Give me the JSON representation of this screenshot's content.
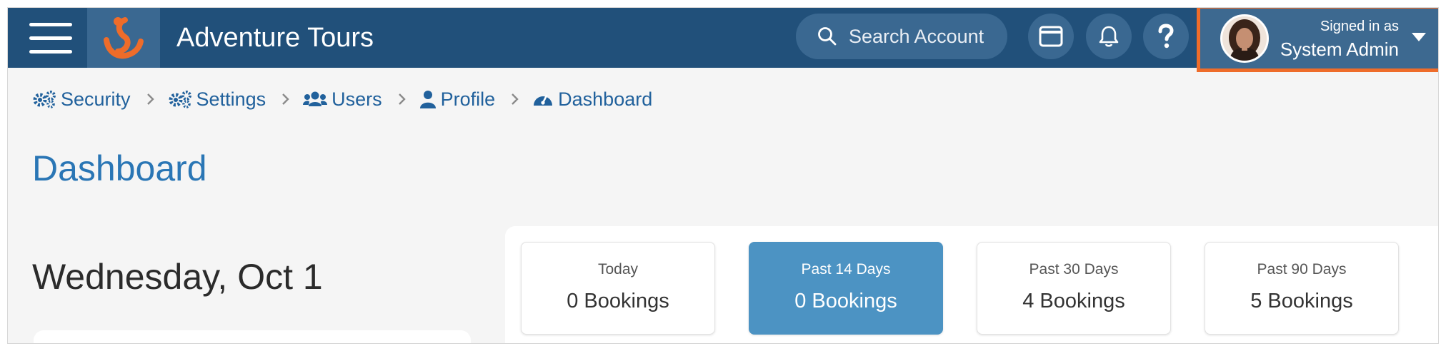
{
  "app": {
    "title": "Adventure Tours"
  },
  "search": {
    "placeholder": "Search Account"
  },
  "user": {
    "signed_in_label": "Signed in as",
    "name": "System Admin"
  },
  "breadcrumb": [
    {
      "label": "Security",
      "icon": "gears-icon"
    },
    {
      "label": "Settings",
      "icon": "gears-icon"
    },
    {
      "label": "Users",
      "icon": "users-icon"
    },
    {
      "label": "Profile",
      "icon": "user-icon"
    },
    {
      "label": "Dashboard",
      "icon": "gauge-icon"
    }
  ],
  "page": {
    "title": "Dashboard",
    "date": "Wednesday, Oct 1"
  },
  "stats": [
    {
      "period": "Today",
      "count": "0 Bookings",
      "active": false
    },
    {
      "period": "Past 14 Days",
      "count": "0 Bookings",
      "active": true
    },
    {
      "period": "Past 30 Days",
      "count": "4 Bookings",
      "active": false
    },
    {
      "period": "Past 90 Days",
      "count": "5 Bookings",
      "active": false
    }
  ],
  "colors": {
    "topbar": "#21507a",
    "accent_orange": "#ee6c2a",
    "link_blue": "#21619c",
    "active_stat": "#4c93c3"
  }
}
